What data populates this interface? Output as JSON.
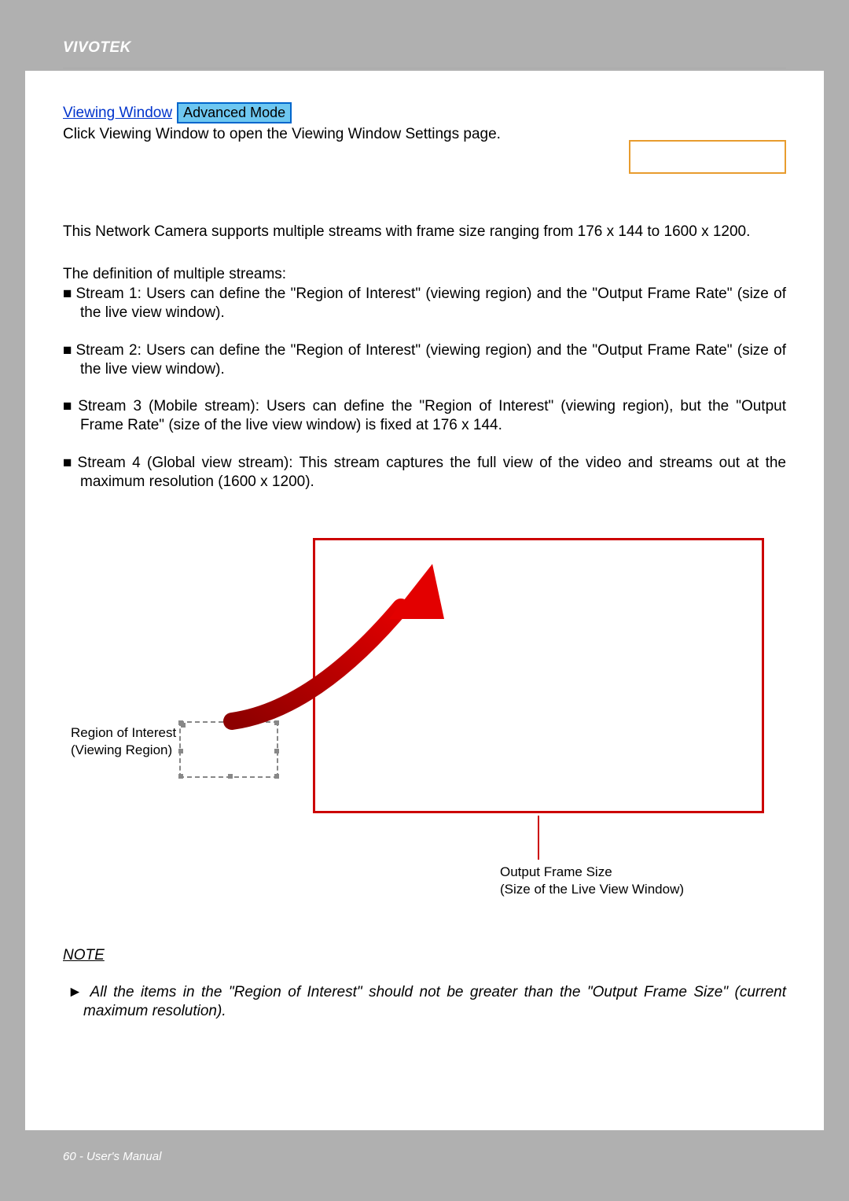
{
  "header": {
    "brand": "VIVOTEK"
  },
  "section": {
    "link_title": "Viewing Window",
    "mode_badge": "Advanced Mode",
    "open_instruction": "Click Viewing Window to open the Viewing Window Settings page."
  },
  "intro": "This Network Camera supports multiple streams with frame size ranging from 176 x 144 to 1600 x 1200.",
  "definitions": {
    "heading": "The definition of multiple streams:",
    "streams": [
      "Stream 1: Users can define the \"Region of Interest\" (viewing region) and the \"Output Frame Rate\" (size of the live view window).",
      "Stream 2: Users can define the \"Region of Interest\" (viewing region) and the \"Output Frame Rate\" (size of the live view window).",
      "Stream 3 (Mobile stream): Users can define the \"Region of Interest\" (viewing region), but the \"Output Frame Rate\" (size of the live view window) is fixed at 176 x 144.",
      "Stream 4 (Global view stream): This stream captures the full view of the video and streams out at the maximum resolution (1600 x 1200)."
    ]
  },
  "diagram": {
    "roi_label_line1": "Region of Interest",
    "roi_label_line2": "(Viewing Region)",
    "output_label_line1": "Output Frame Size",
    "output_label_line2": "(Size of the Live View Window)"
  },
  "note": {
    "heading": "NOTE",
    "items": [
      "All the items in the \"Region of Interest\" should not be greater than the \"Output Frame Size\" (current maximum resolution)."
    ]
  },
  "footer": {
    "page_label": "60 - User's Manual"
  }
}
